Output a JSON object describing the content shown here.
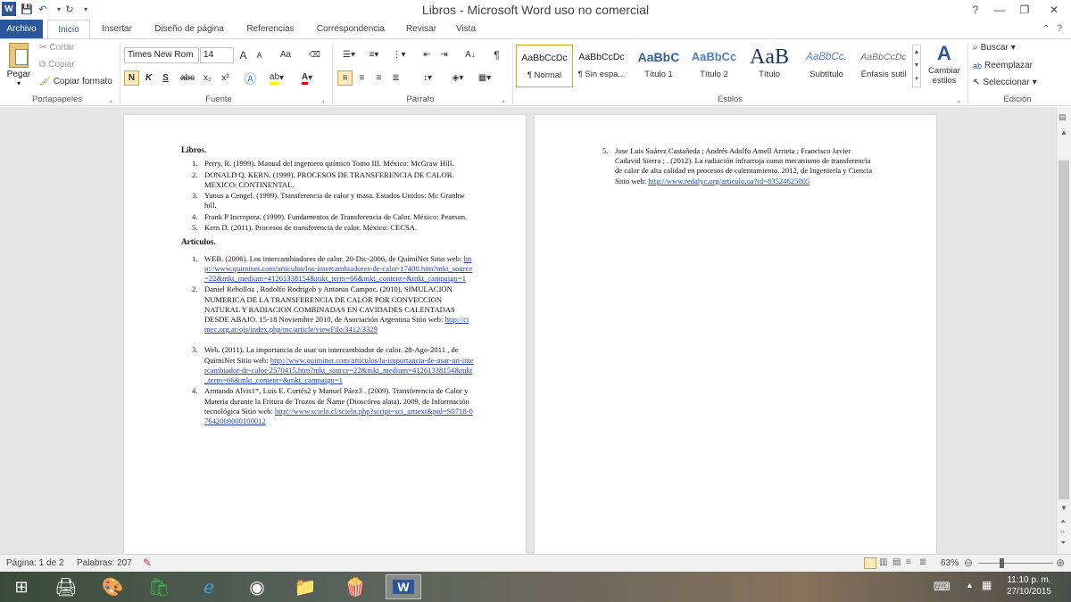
{
  "title_bar": {
    "title": "Libros - Microsoft Word uso no comercial",
    "help": "?",
    "minimize": "—",
    "restore": "❐",
    "close": "✕"
  },
  "tabs": [
    {
      "label": "Archivo"
    },
    {
      "label": "Inicio"
    },
    {
      "label": "Insertar"
    },
    {
      "label": "Diseño de página"
    },
    {
      "label": "Referencias"
    },
    {
      "label": "Correspondencia"
    },
    {
      "label": "Revisar"
    },
    {
      "label": "Vista"
    }
  ],
  "ribbon": {
    "clipboard": {
      "paste": "Pegar",
      "cut": "Cortar",
      "copy": "Copiar",
      "format_painter": "Copiar formato",
      "group": "Portapapeles"
    },
    "font": {
      "name": "Times New Rom",
      "size": "14",
      "group": "Fuente",
      "bold": "N",
      "italic": "K",
      "underline": "S",
      "strike": "abc",
      "sub": "x₂",
      "sup": "x²",
      "grow": "A",
      "shrink": "A",
      "case": "Aa"
    },
    "paragraph": {
      "group": "Párrafo"
    },
    "styles": {
      "group": "Estilos",
      "items": [
        {
          "preview": "AaBbCcDc",
          "name": "¶ Normal"
        },
        {
          "preview": "AaBbCcDc",
          "name": "¶ Sin espa..."
        },
        {
          "preview": "AaBbC",
          "name": "Título 1"
        },
        {
          "preview": "AaBbCc",
          "name": "Título 2"
        },
        {
          "preview": "AaB",
          "name": "Título"
        },
        {
          "preview": "AaBbCc.",
          "name": "Subtítulo"
        },
        {
          "preview": "AaBbCcDc",
          "name": "Énfasis sutil"
        }
      ],
      "change_styles": "Cambiar estilos"
    },
    "editing": {
      "group": "Edición",
      "find": "Buscar",
      "replace": "Reemplazar",
      "select": "Seleccionar"
    }
  },
  "document": {
    "heading_books": "Libros.",
    "books": [
      "Perry, R. (1999). Manual del ingeniero químico Tomo III. México: McGraw Hill.",
      "DONALD Q. KERN. (1999). PROCESOS DE TRANSFERENCIA DE CALOR. MEXICO: CONTINENTAL.",
      "Yunus a Cengel. (1999). Transferencia de calor y masa. Estados Unidos: Mc Granhw hill.",
      "Frank P Incropera. (1999). Fundamentos de Transferencia de Calor. México: Pearson.",
      "Kern D. (2011). Procesos de transferencia de calor. México: CECSA."
    ],
    "heading_articles": "Artículos.",
    "articles": [
      {
        "text": "WEB. (2006). Los intercambiadores de calor. 20-Dic-2006, de QuimiNet Sitio web: ",
        "link": "http://www.quiminet.com/articulos/los-intercambiadores-de-calor-17400.htm?mkt_source=22&mkt_medium=41261338154&mkt_term=66&mkt_content=&mkt_campaign=1"
      },
      {
        "text": "Daniel Rebolloa , Rodolfo Rodrigob y Antonio Campoc. (2010). SIMULACION NUMERICA DE LA TRANSFERENCIA DE CALOR POR CONVECCION NATURAL Y RADIACION COMBINADAS EN CAVIDADES CALENTADAS DESDE ABAJO. 15-18 Noviembre 2010, de Asociación Argentina Sitio web: ",
        "link": "http://cimec.org.ar/ojs/index.php/mc/article/viewFile/3412/3329"
      },
      {
        "text": "Web. (2011). La importancia de usar un intercambiador de calor. 28-Ago-2011 , de QuimiNet Sitio web: ",
        "link": "http://www.quiminet.com/articulos/la-importancia-de-usar-un-intercambiador-de-calor-2570415.htm?mkt_source=22&mkt_medium=41261338154&mkt_term=66&mkt_content=&mkt_campaign=1"
      },
      {
        "text": "Armando Alvis1*, Luis E. Cortés2 y Manuel Páez3 . (2009). Transferencia de Calor y Materia durante la Fritura de Trozos de Ñame (Dioscórea alata). 2009, de Información tecnológica Sitio web: ",
        "link": "http://www.scielo.cl/scielo.php?script=sci_arttext&pid=S0718-07642009000100012"
      },
      {
        "text": "Jose Luis Suárez Castañeda ; Andrés Adolfo Amell Arrieta ; Francisco Javier Cadavid Sierra ; . (2012). La radiación infrarroja como mecanismo de transferencia de calor de alta calidad en procesos de calentamiento. 2012, de Ingeniería y Ciencia Sitio web: ",
        "link": "http://www.redalyc.org/articulo.oa?id=83524625005"
      }
    ]
  },
  "status_bar": {
    "page": "Página: 1 de 2",
    "words": "Palabras: 207",
    "zoom": "63%"
  },
  "taskbar": {
    "time": "11:10 p. m.",
    "date": "27/10/2015"
  }
}
